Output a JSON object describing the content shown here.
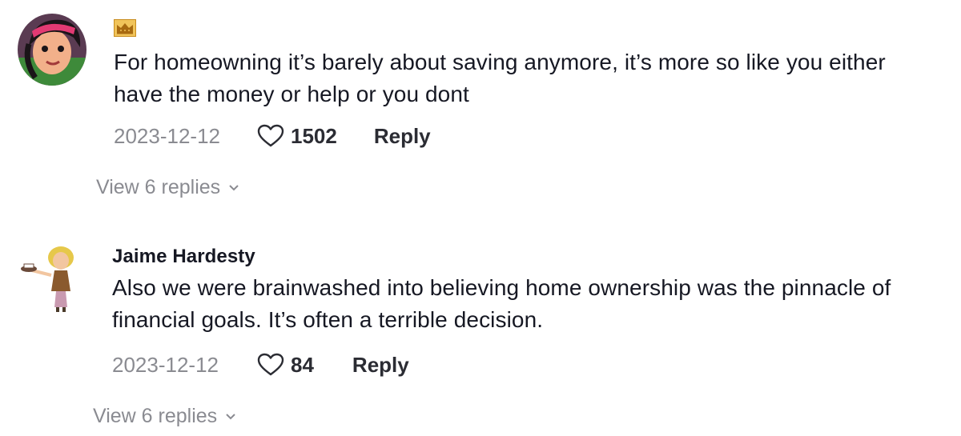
{
  "comments": [
    {
      "username": "",
      "badge_icon": "crown-badge-icon",
      "text": "For homeowning it’s barely about saving anymore, it’s more so like you either have the money or help or you dont",
      "date": "2023-12-12",
      "likes": "1502",
      "reply_label": "Reply",
      "view_replies_label": "View 6 replies"
    },
    {
      "username": "Jaime Hardesty",
      "text": "Also we were brainwashed into believing home ownership was the pinnacle of financial goals. It’s often a terrible decision.",
      "date": "2023-12-12",
      "likes": "84",
      "reply_label": "Reply",
      "view_replies_label": "View 6 replies"
    }
  ],
  "colors": {
    "text": "#161823",
    "muted": "#8a8b91",
    "badge": "#e8b84a"
  }
}
